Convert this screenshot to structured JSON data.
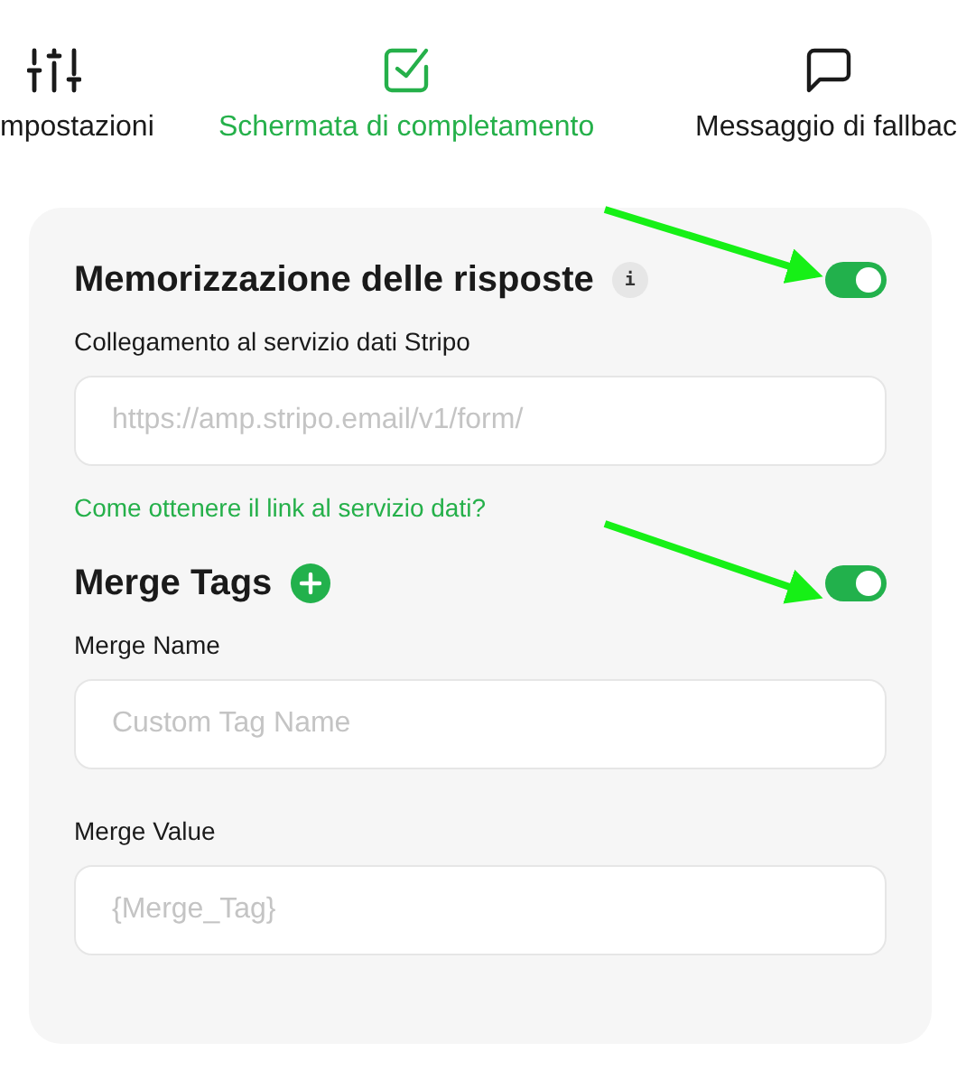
{
  "tabs": [
    {
      "label": "mpostazioni",
      "kind": "sliders",
      "selected": false
    },
    {
      "label": "Schermata di completamento",
      "kind": "checkbox",
      "selected": true
    },
    {
      "label": "Messaggio di fallbac",
      "kind": "message",
      "selected": false
    }
  ],
  "storage": {
    "title": "Memorizzazione delle risposte",
    "info": "i",
    "on": true,
    "field_label": "Collegamento al servizio dati Stripo",
    "placeholder": "https://amp.stripo.email/v1/form/",
    "help_link": "Come ottenere il link al servizio dati?"
  },
  "merge_tags": {
    "title": "Merge Tags",
    "on": true,
    "fields": [
      {
        "label": "Merge Name",
        "placeholder": "Custom Tag Name"
      },
      {
        "label": "Merge Value",
        "placeholder": "{Merge_Tag}"
      }
    ]
  }
}
